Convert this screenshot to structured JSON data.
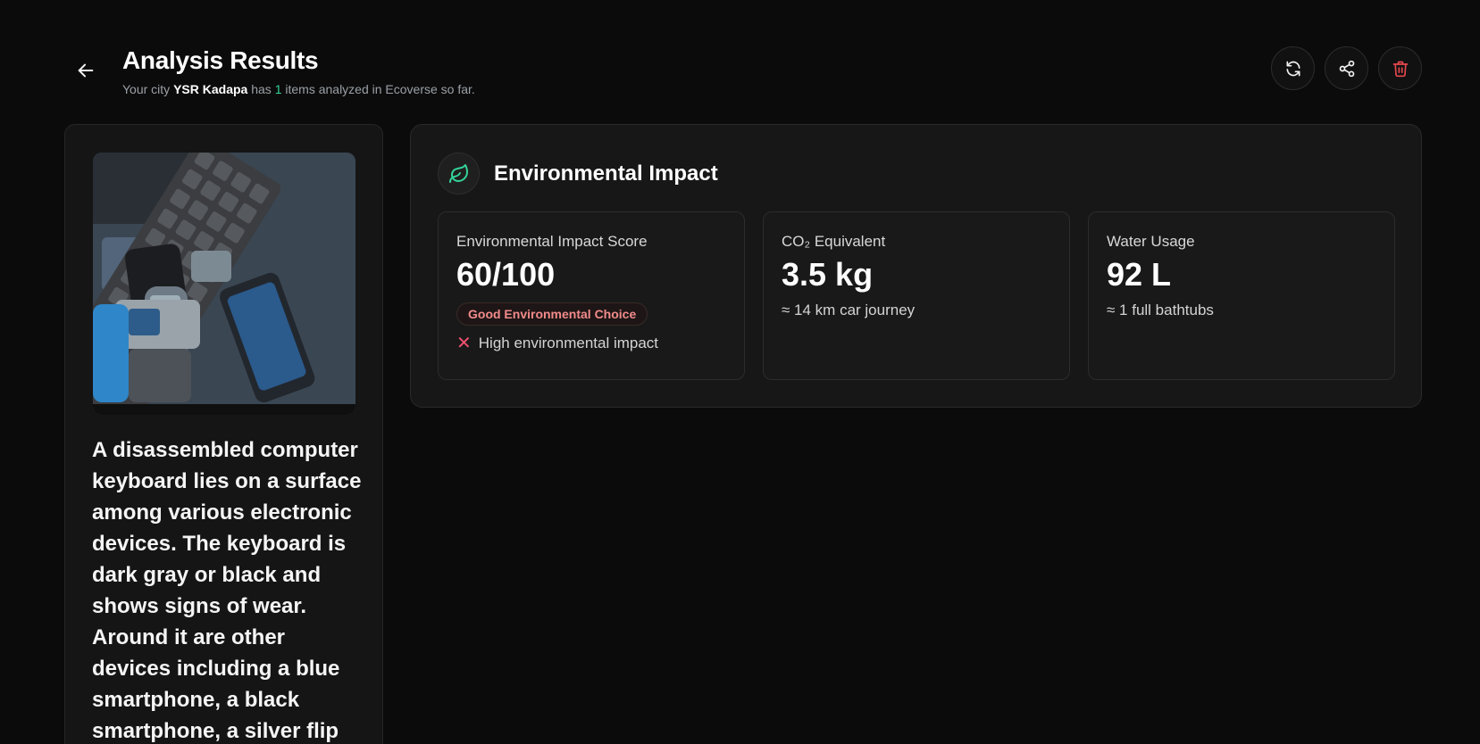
{
  "header": {
    "title": "Analysis Results",
    "subtitle_prefix": "Your city",
    "city": "YSR Kadapa",
    "subtitle_mid": "has",
    "count": "1",
    "subtitle_suffix": "items analyzed in Ecoverse so far."
  },
  "actions": {
    "back_icon": "arrow-left-icon",
    "refresh_icon": "refresh-icon",
    "share_icon": "share-icon",
    "delete_icon": "trash-icon",
    "delete_color": "#e5484d"
  },
  "item": {
    "description": "A disassembled computer keyboard lies on a surface among various electronic devices. The keyboard is dark gray or black and shows signs of wear. Around it are other devices including a blue smartphone, a black smartphone, a silver flip"
  },
  "impact": {
    "title": "Environmental Impact",
    "icon": "leaf-icon",
    "accent": "#34d399",
    "score": {
      "label": "Environmental Impact Score",
      "value": "60/100",
      "badge": "Good Environmental Choice",
      "note": "High environmental impact"
    },
    "co2": {
      "label": "CO₂ Equivalent",
      "value": "3.5 kg",
      "note": "≈ 14 km car journey"
    },
    "water": {
      "label": "Water Usage",
      "value": "92 L",
      "note": "≈ 1 full bathtubs"
    }
  }
}
